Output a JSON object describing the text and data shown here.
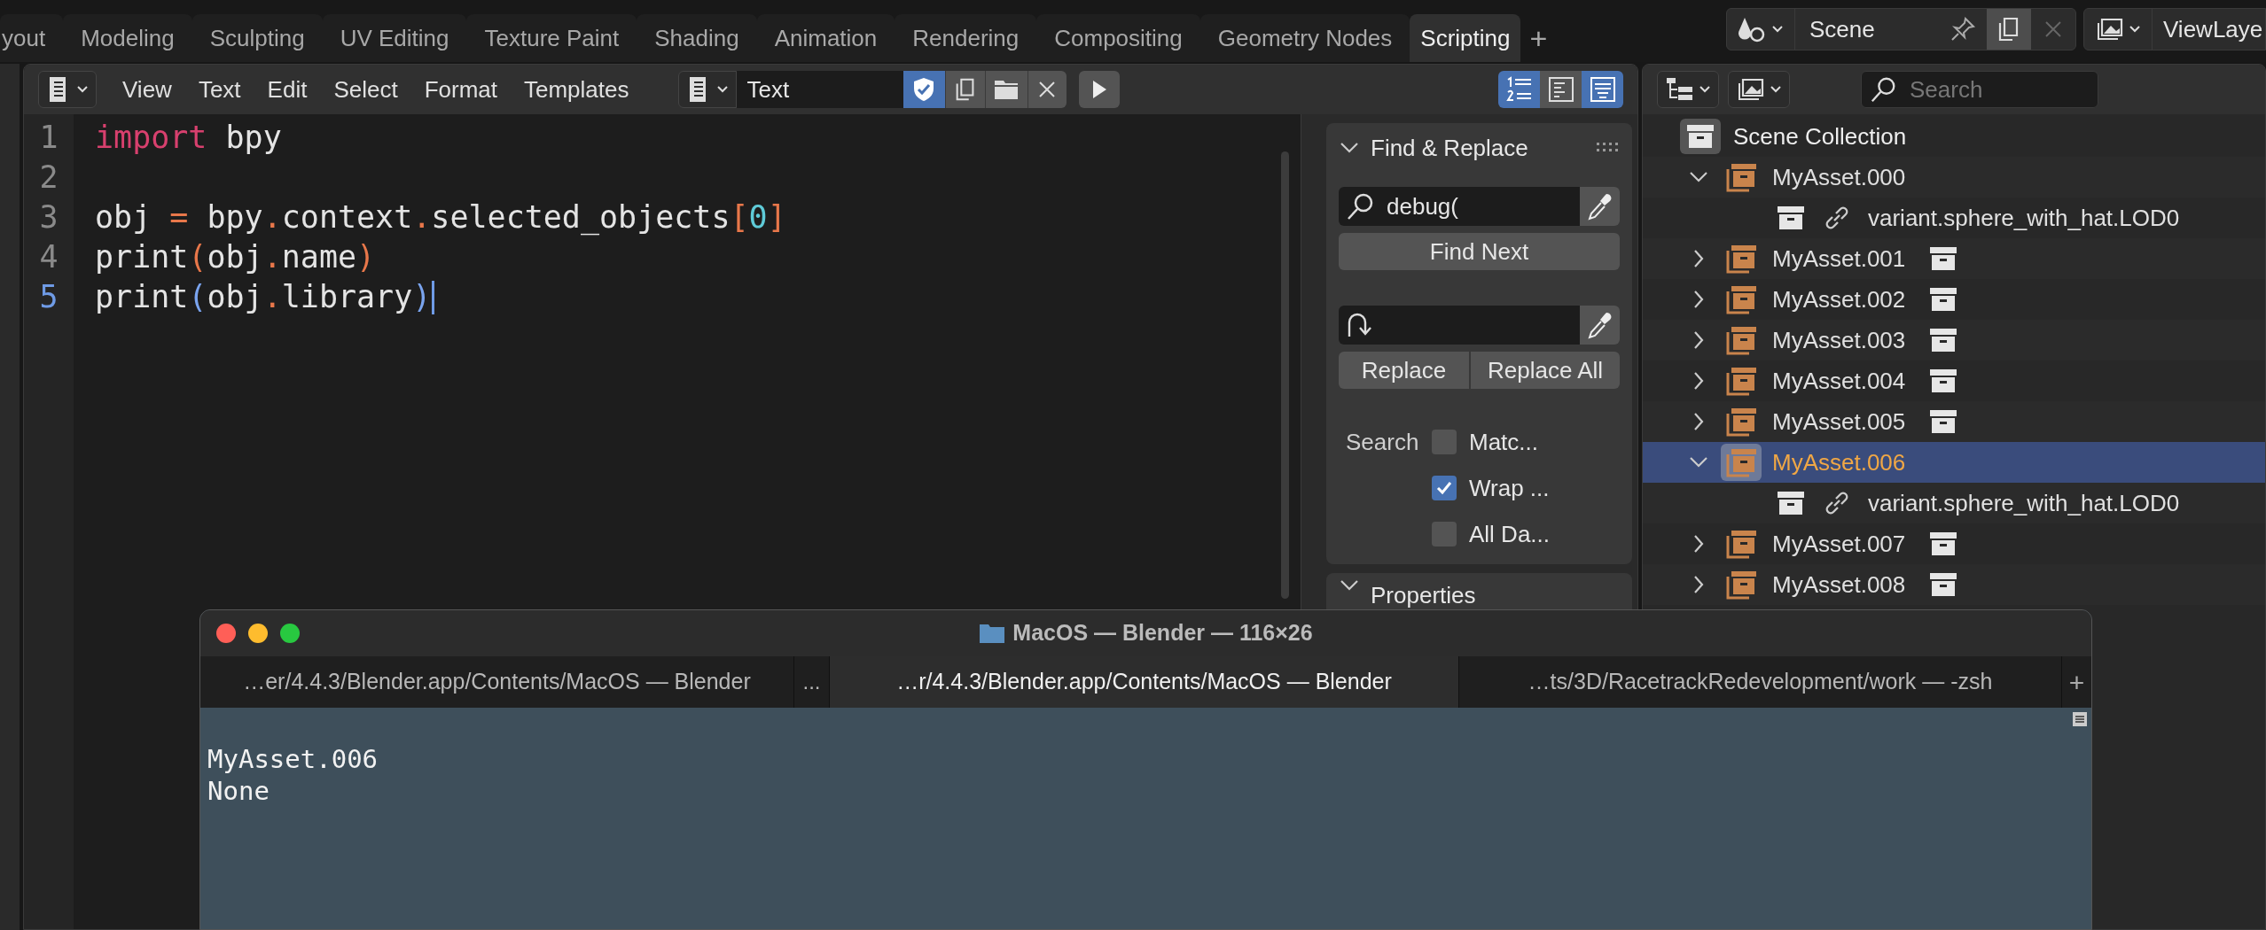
{
  "workspace_tabs": [
    {
      "label": "yout",
      "selected": false
    },
    {
      "label": "Modeling",
      "selected": false
    },
    {
      "label": "Sculpting",
      "selected": false
    },
    {
      "label": "UV Editing",
      "selected": false
    },
    {
      "label": "Texture Paint",
      "selected": false
    },
    {
      "label": "Shading",
      "selected": false
    },
    {
      "label": "Animation",
      "selected": false
    },
    {
      "label": "Rendering",
      "selected": false
    },
    {
      "label": "Compositing",
      "selected": false
    },
    {
      "label": "Geometry Nodes",
      "selected": false
    },
    {
      "label": "Scripting",
      "selected": true
    }
  ],
  "add_tab": "+",
  "scene": {
    "name": "Scene"
  },
  "view_layer": {
    "name": "ViewLaye"
  },
  "text_editor": {
    "menu": [
      "View",
      "Text",
      "Edit",
      "Select",
      "Format",
      "Templates"
    ],
    "text_name": "Text",
    "toggles": [
      {
        "kind": "line-numbers",
        "on": true
      },
      {
        "kind": "word-wrap",
        "on": false
      },
      {
        "kind": "syntax",
        "on": true
      }
    ],
    "lines": [
      {
        "number": "1",
        "current": false,
        "tokens": [
          {
            "text": "import",
            "kind": "keyword"
          },
          {
            "text": " bpy",
            "kind": "plain"
          }
        ]
      },
      {
        "number": "2",
        "current": false
      },
      {
        "number": "3",
        "current": false,
        "tokens": [
          {
            "text": "obj ",
            "kind": "plain"
          },
          {
            "text": "=",
            "kind": "operator"
          },
          {
            "text": " bpy",
            "kind": "plain"
          },
          {
            "text": ".",
            "kind": "operator"
          },
          {
            "text": "context",
            "kind": "plain"
          },
          {
            "text": ".",
            "kind": "operator"
          },
          {
            "text": "selected_objects",
            "kind": "plain"
          },
          {
            "text": "[",
            "kind": "operator"
          },
          {
            "text": "0",
            "kind": "number"
          },
          {
            "text": "]",
            "kind": "operator"
          }
        ]
      },
      {
        "number": "4",
        "current": false,
        "tokens": [
          {
            "text": "print",
            "kind": "plain"
          },
          {
            "text": "(",
            "kind": "operator"
          },
          {
            "text": "obj",
            "kind": "plain"
          },
          {
            "text": ".",
            "kind": "operator"
          },
          {
            "text": "name",
            "kind": "plain"
          },
          {
            "text": ")",
            "kind": "operator"
          }
        ]
      },
      {
        "number": "5",
        "current": true,
        "tokens": [
          {
            "text": "print",
            "kind": "plain"
          },
          {
            "text": "(",
            "kind": "match"
          },
          {
            "text": "obj",
            "kind": "plain"
          },
          {
            "text": ".",
            "kind": "operator"
          },
          {
            "text": "library",
            "kind": "plain"
          },
          {
            "text": ")",
            "kind": "match"
          }
        ]
      }
    ]
  },
  "find_replace": {
    "title": "Find & Replace",
    "find_value": "debug(",
    "find_button": "Find Next",
    "replace_buttons": [
      "Replace",
      "Replace All"
    ],
    "search_label": "Search",
    "options": [
      {
        "label": "Matc...",
        "checked": false
      },
      {
        "label": "Wrap ...",
        "checked": true
      },
      {
        "label": "All Da...",
        "checked": false
      }
    ]
  },
  "properties_panel": {
    "title": "Properties"
  },
  "outliner": {
    "search_placeholder": "Search",
    "tree": {
      "name": "Scene Collection",
      "children": [
        {
          "name": "MyAsset.000",
          "kind": "collection",
          "expanded": true,
          "selected": false,
          "children": [
            {
              "name": "variant.sphere_with_hat.LOD0",
              "kind": "linked",
              "selected": false
            }
          ]
        },
        {
          "name": "MyAsset.001",
          "kind": "collection",
          "expanded": false,
          "selected": false
        },
        {
          "name": "MyAsset.002",
          "kind": "collection",
          "expanded": false,
          "selected": false
        },
        {
          "name": "MyAsset.003",
          "kind": "collection",
          "expanded": false,
          "selected": false
        },
        {
          "name": "MyAsset.004",
          "kind": "collection",
          "expanded": false,
          "selected": false
        },
        {
          "name": "MyAsset.005",
          "kind": "collection",
          "expanded": false,
          "selected": false
        },
        {
          "name": "MyAsset.006",
          "kind": "collection",
          "expanded": true,
          "selected": true,
          "children": [
            {
              "name": "variant.sphere_with_hat.LOD0",
              "kind": "linked",
              "selected": false
            }
          ]
        },
        {
          "name": "MyAsset.007",
          "kind": "collection",
          "expanded": false,
          "selected": false
        },
        {
          "name": "MyAsset.008",
          "kind": "collection",
          "expanded": false,
          "selected": false
        }
      ]
    }
  },
  "terminal": {
    "title": "MacOS — Blender — 116×26",
    "tabs": [
      {
        "label": "…er/4.4.3/Blender.app/Contents/MacOS — Blender",
        "selected": false
      },
      {
        "label": "…r/4.4.3/Blender.app/Contents/MacOS — Blender",
        "selected": true
      },
      {
        "label": "…ts/3D/RacetrackRedevelopment/work — -zsh",
        "selected": false
      }
    ],
    "more": "...",
    "add_tab": "+",
    "output": [
      "MyAsset.006",
      "None"
    ]
  }
}
